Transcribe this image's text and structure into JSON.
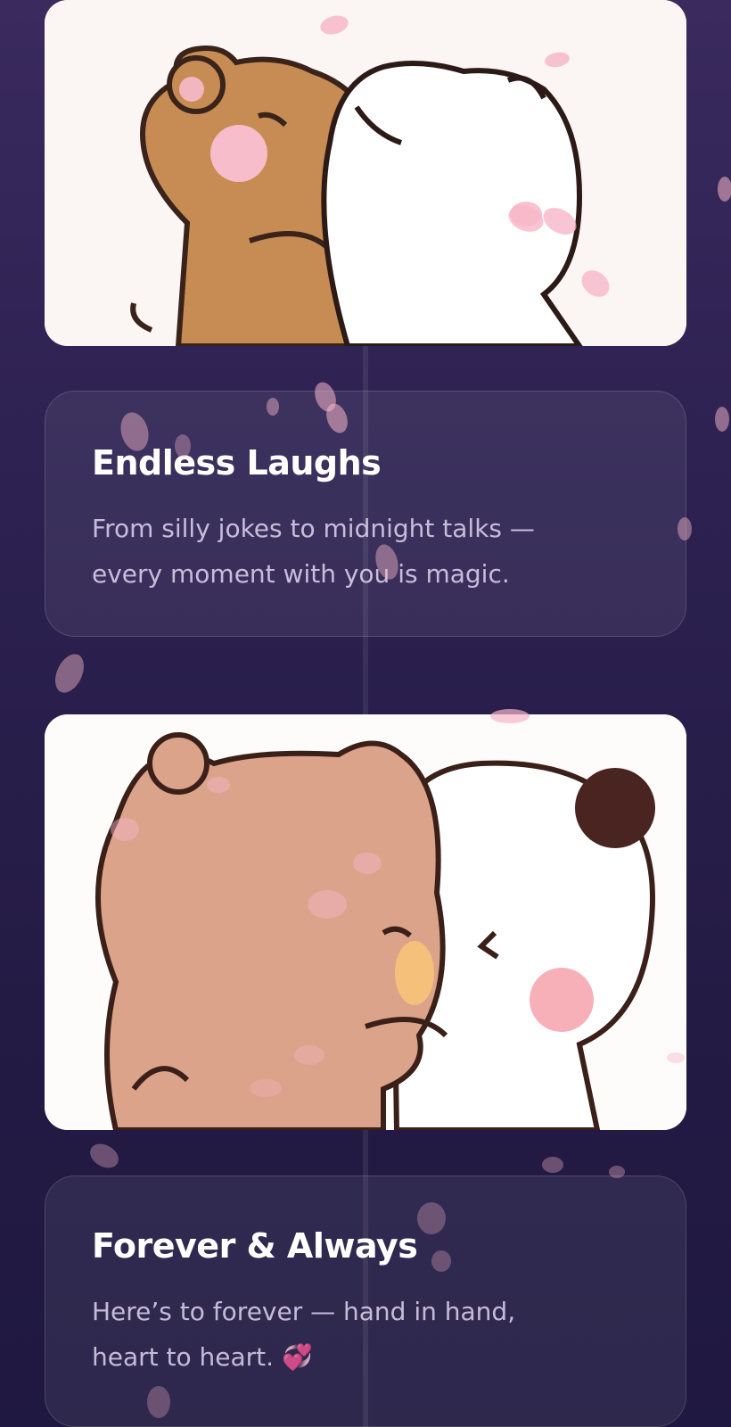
{
  "timeline": {
    "cards": [
      {
        "image_name": "teddy-hug-illustration",
        "title": "Endless Laughs",
        "text_line1": "From silly jokes to midnight talks —",
        "text_line2": "every moment with you is magic."
      },
      {
        "image_name": "bear-panda-kiss-illustration",
        "title": "Forever & Always",
        "text_line1": "Here’s to forever — hand in hand,",
        "text_line2": "heart to heart. 💞"
      }
    ]
  },
  "colors": {
    "background_top": "#3a2a5e",
    "background_bottom": "#1f1840",
    "petal": "#f7b7c9"
  }
}
